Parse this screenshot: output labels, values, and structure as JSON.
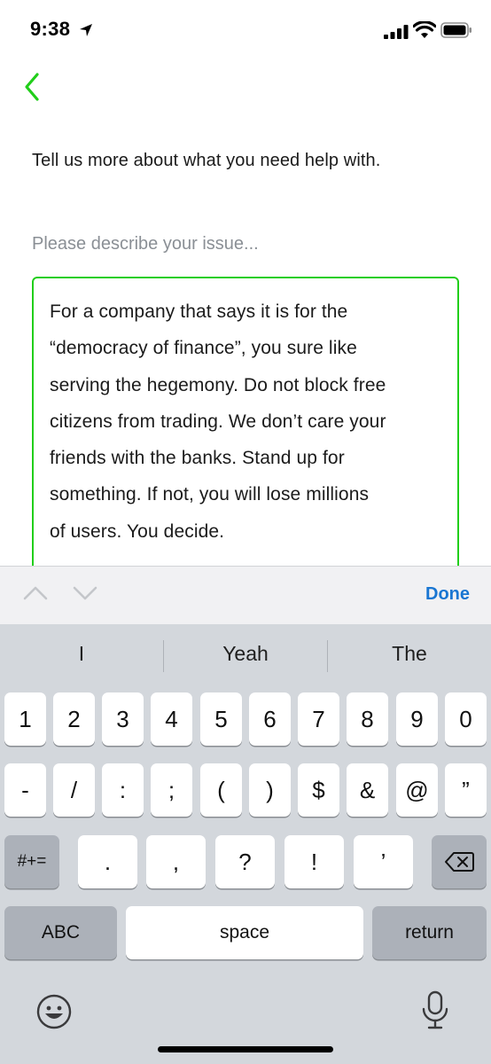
{
  "status_bar": {
    "time": "9:38"
  },
  "form": {
    "prompt": "Tell us more about what you need help with.",
    "label": "Please describe your issue...",
    "issue_text": "For a company that says it is for the\n“democracy of finance”, you sure like\nserving the hegemony. Do not block free\ncitizens from trading. We don’t care your\nfriends with the banks. Stand up for\nsomething. If not, you will lose millions\nof users. You decide."
  },
  "accessory": {
    "done_label": "Done"
  },
  "keyboard": {
    "suggestions": [
      "I",
      "Yeah",
      "The"
    ],
    "row1": [
      "1",
      "2",
      "3",
      "4",
      "5",
      "6",
      "7",
      "8",
      "9",
      "0"
    ],
    "row2": [
      "-",
      "/",
      ":",
      ";",
      "(",
      ")",
      "$",
      "&",
      "@",
      "”"
    ],
    "row3": [
      ".",
      ",",
      "?",
      "!",
      "’"
    ],
    "symbols_key": "#+=",
    "abc_key": "ABC",
    "space_key": "space",
    "return_key": "return"
  },
  "colors": {
    "accent_green": "#21ce1a",
    "done_blue": "#1976d2",
    "keyboard_bg": "#d3d7dc"
  }
}
